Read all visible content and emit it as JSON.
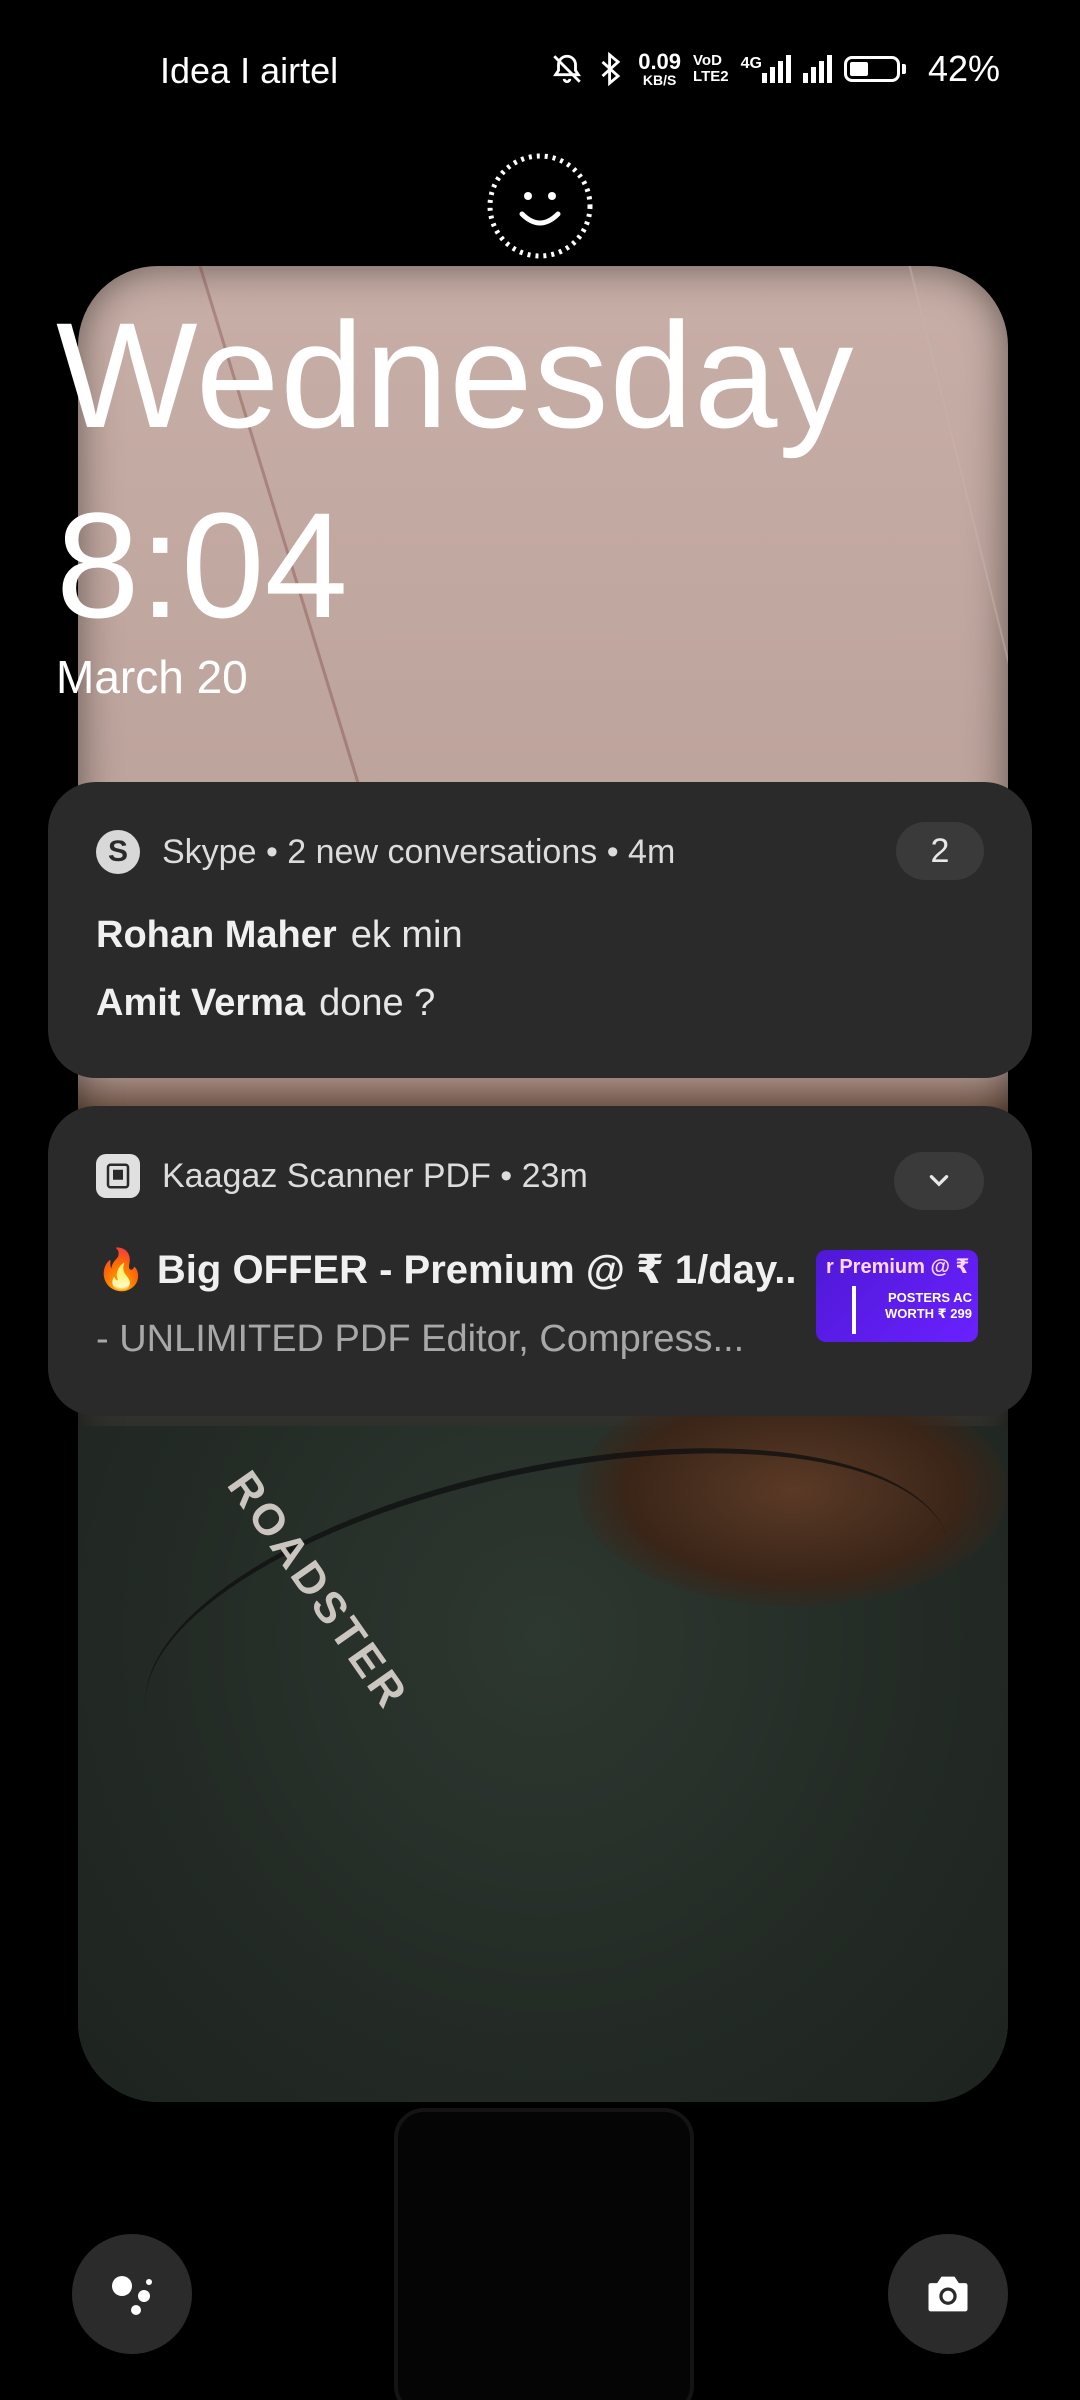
{
  "status_bar": {
    "carrier": "Idea I airtel",
    "net_speed_value": "0.09",
    "net_speed_unit": "KB/S",
    "volte_line1": "VoD",
    "volte_line2": "LTE2",
    "network_type": "4G",
    "battery_percent": "42%",
    "battery_level": 0.42,
    "icons": [
      "bell-muted-icon",
      "bluetooth-icon",
      "signal-icon",
      "battery-icon"
    ]
  },
  "lockscreen": {
    "day": "Wednesday",
    "time": "8:04",
    "date": "March 20"
  },
  "notifications": [
    {
      "app": "Skype",
      "app_icon_letter": "S",
      "summary": "Skype • 2 new conversations • 4m",
      "count": "2",
      "messages": [
        {
          "sender": "Rohan Maher",
          "text": "ek min"
        },
        {
          "sender": "Amit Verma",
          "text": "done ?"
        }
      ]
    },
    {
      "app": "Kaagaz Scanner PDF",
      "summary": "Kaagaz Scanner PDF • 23m",
      "title": "🔥 Big OFFER - Premium @ ₹ 1/day..",
      "body": "- UNLIMITED PDF Editor, Compress...",
      "thumb_line1": "r Premium @ ₹",
      "thumb_line2": "POSTERS AC",
      "thumb_line3": "WORTH ₹ 299"
    }
  ],
  "colors": {
    "notification_bg": "#2a2a2a",
    "badge_bg": "#3a3a3a",
    "thumb_purple": "#5a1ce8"
  }
}
